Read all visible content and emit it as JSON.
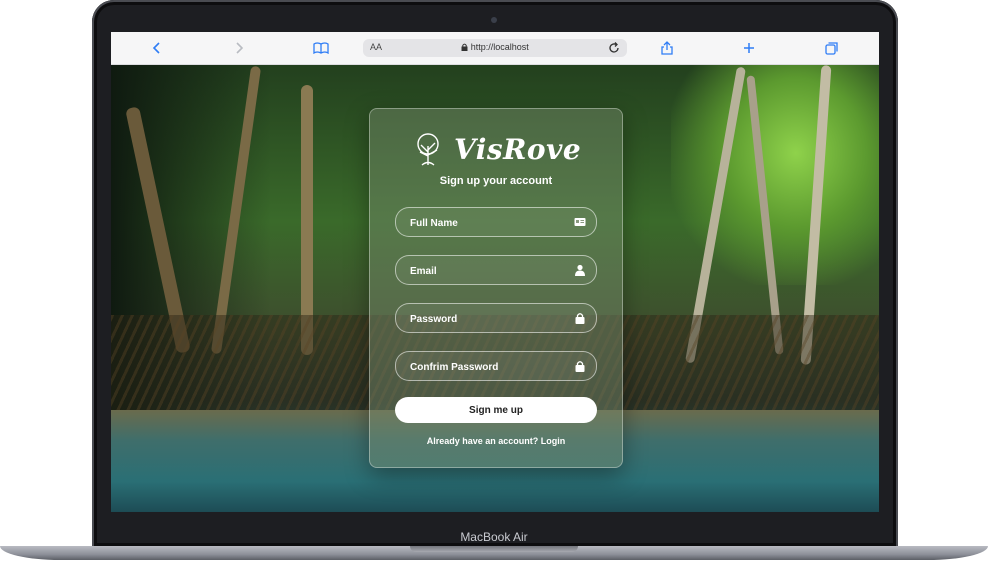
{
  "device": {
    "label": "MacBook Air"
  },
  "browser": {
    "text_size_label": "AA",
    "url": "http://localhost",
    "icons": [
      "back-icon",
      "forward-icon",
      "bookmarks-icon",
      "lock-icon",
      "reload-icon",
      "share-icon",
      "new-tab-icon",
      "tabs-icon"
    ]
  },
  "card": {
    "brand": "VisRove",
    "subtitle": "Sign up your account",
    "fields": {
      "full_name": {
        "placeholder": "Full Name",
        "icon": "id-card-icon"
      },
      "email": {
        "placeholder": "Email",
        "icon": "user-icon"
      },
      "password": {
        "placeholder": "Password",
        "icon": "lock-icon"
      },
      "confirm_password": {
        "placeholder": "Confrim Password",
        "icon": "lock-icon"
      }
    },
    "submit_label": "Sign me up",
    "login_prompt": "Already have an account?",
    "login_link": "Login"
  }
}
